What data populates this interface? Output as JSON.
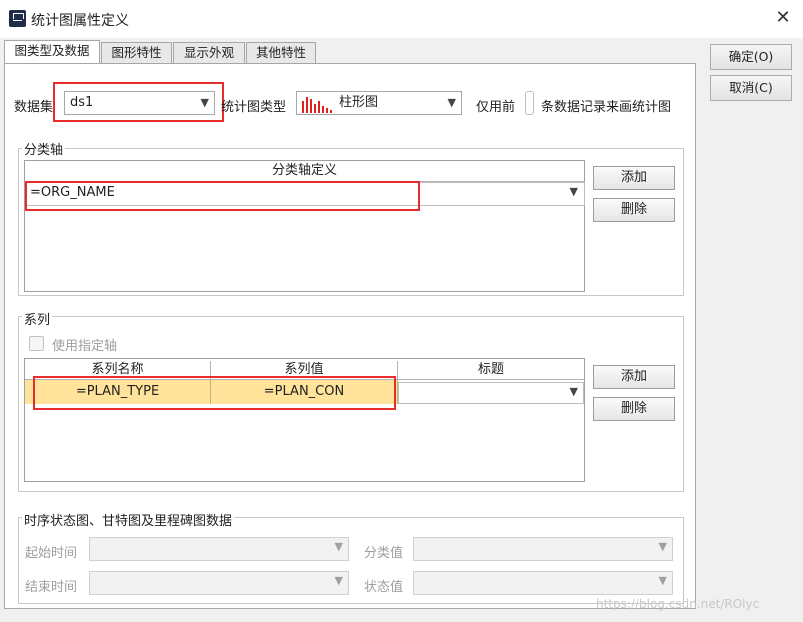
{
  "window": {
    "title": "统计图属性定义",
    "close_symbol": "✕"
  },
  "tabs": [
    "图类型及数据",
    "图形特性",
    "显示外观",
    "其他特性"
  ],
  "side_buttons": {
    "ok": "确定(O)",
    "cancel": "取消(C)"
  },
  "top": {
    "dataset_label": "数据集",
    "dataset_value": "ds1",
    "charttype_label": "统计图类型",
    "charttype_value": "柱形图",
    "only_prefix": "仅用前",
    "only_suffix": "条数据记录来画统计图"
  },
  "category_axis": {
    "legend": "分类轴",
    "header": "分类轴定义",
    "row_value": "=ORG_NAME",
    "add": "添加",
    "delete": "删除"
  },
  "series": {
    "legend": "系列",
    "use_axis": "使用指定轴",
    "headers": [
      "系列名称",
      "系列值",
      "标题"
    ],
    "row": {
      "name": "=PLAN_TYPE",
      "value": "=PLAN_CON",
      "title": ""
    },
    "add": "添加",
    "delete": "删除"
  },
  "timing": {
    "legend": "时序状态图、甘特图及里程碑图数据",
    "start_time": "起始时间",
    "end_time": "结束时间",
    "category_value": "分类值",
    "state_value": "状态值"
  },
  "watermark": "https://blog.csdn.net/ROlyc",
  "colors": {
    "highlight_row": "#ffe39a",
    "red_box": "#e52d2d",
    "bar_icon": "#e0201c"
  }
}
